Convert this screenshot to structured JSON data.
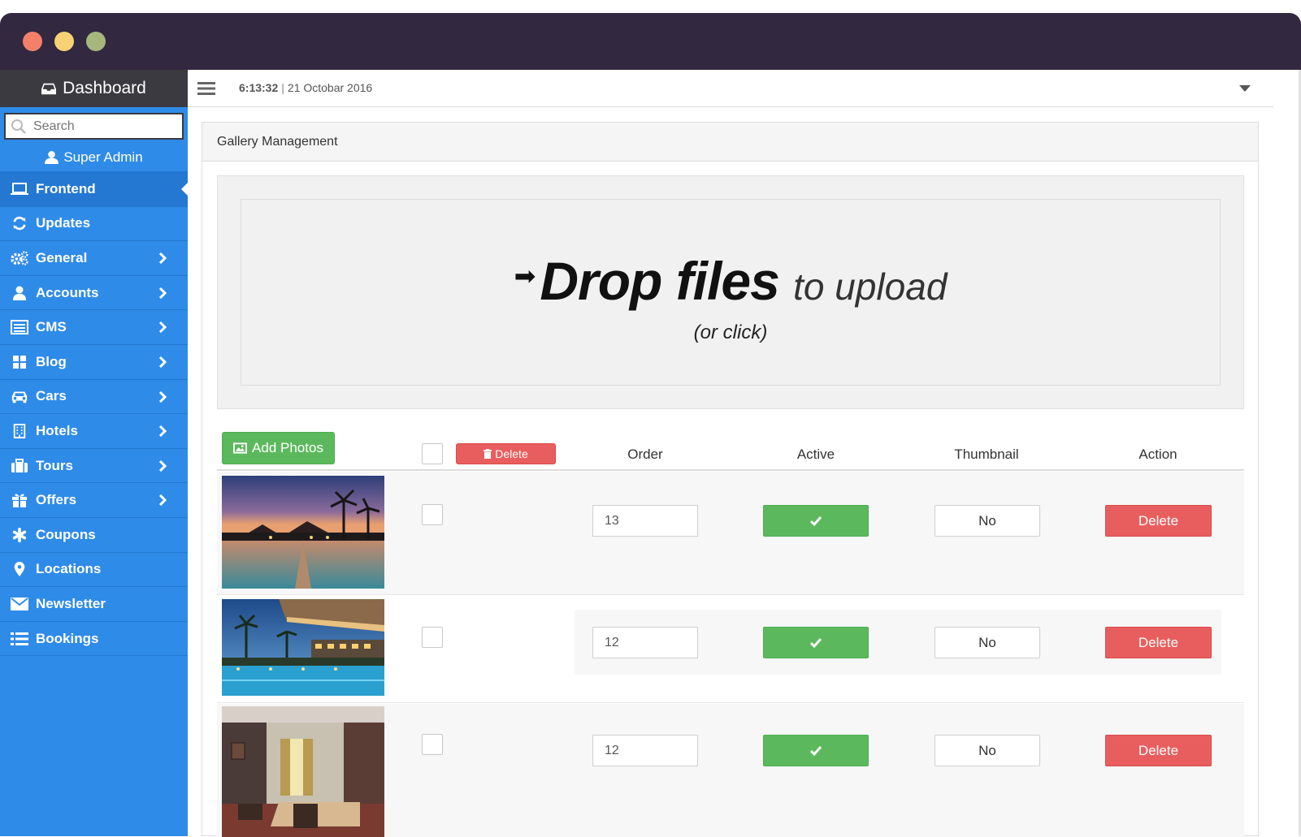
{
  "sidebar": {
    "brand": "Dashboard",
    "search_placeholder": "Search",
    "user": "Super Admin",
    "items": [
      {
        "label": "Frontend",
        "icon": "laptop-icon"
      },
      {
        "label": "Updates",
        "icon": "refresh-icon"
      },
      {
        "label": "General",
        "icon": "gears-icon"
      },
      {
        "label": "Accounts",
        "icon": "user-icon"
      },
      {
        "label": "CMS",
        "icon": "list-alt-icon"
      },
      {
        "label": "Blog",
        "icon": "grid-icon"
      },
      {
        "label": "Cars",
        "icon": "car-icon"
      },
      {
        "label": "Hotels",
        "icon": "building-icon"
      },
      {
        "label": "Tours",
        "icon": "suitcase-icon"
      },
      {
        "label": "Offers",
        "icon": "gift-icon"
      },
      {
        "label": "Coupons",
        "icon": "asterisk-icon"
      },
      {
        "label": "Locations",
        "icon": "map-marker-icon"
      },
      {
        "label": "Newsletter",
        "icon": "envelope-icon"
      },
      {
        "label": "Bookings",
        "icon": "list-icon"
      }
    ]
  },
  "topbar": {
    "time": "6:13:32",
    "separator": "|",
    "date": "21 Octobar 2016"
  },
  "panel": {
    "title": "Gallery Management",
    "dropzone": {
      "bold": "Drop files",
      "light": "to upload",
      "sub": "(or click)"
    }
  },
  "table": {
    "add_photos": "Add Photos",
    "delete_selected": "Delete",
    "headers": {
      "order": "Order",
      "active": "Active",
      "thumbnail": "Thumbnail",
      "action": "Action"
    },
    "rows": [
      {
        "order": "13",
        "thumbnail": "No",
        "action": "Delete",
        "image": "beach-resort-pier-photo"
      },
      {
        "order": "12",
        "thumbnail": "No",
        "action": "Delete",
        "image": "hotel-pool-night-photo"
      },
      {
        "order": "12",
        "thumbnail": "No",
        "action": "Delete",
        "image": "hotel-room-interior-photo"
      }
    ]
  },
  "colors": {
    "sidebar": "#2f8be8",
    "brand_bar": "#3a3a40",
    "titlebar": "#32283f",
    "success": "#5cb85c",
    "danger": "#e85e5e"
  }
}
